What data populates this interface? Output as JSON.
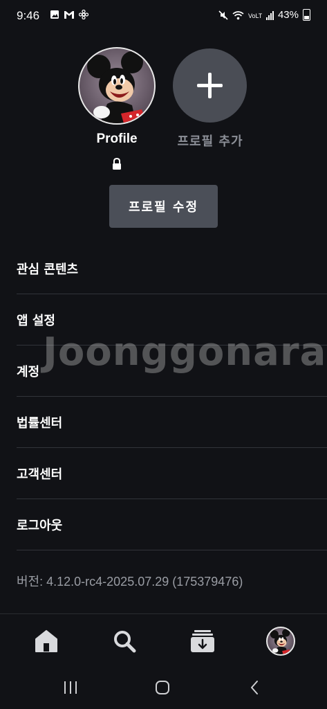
{
  "status_bar": {
    "time": "9:46",
    "left_icons": [
      "gallery-icon",
      "gmail-icon",
      "pinwheel-icon"
    ],
    "right_icons": [
      "mute-icon",
      "wifi-icon",
      "volte-icon",
      "signal-icon"
    ],
    "battery": "43%"
  },
  "profiles": {
    "current_name": "Profile",
    "add_label": "프로필 추가",
    "edit_button": "프로필 수정"
  },
  "menu": {
    "items": [
      "관심 콘텐츠",
      "앱 설정",
      "계정",
      "법률센터",
      "고객센터",
      "로그아웃"
    ]
  },
  "version": "버전: 4.12.0-rc4-2025.07.29 (175379476)",
  "watermark": "Joonggonara",
  "bottom_nav": [
    "home-icon",
    "search-icon",
    "downloads-icon",
    "profile-avatar"
  ],
  "system_nav": [
    "recents-icon",
    "home-button-icon",
    "back-icon"
  ],
  "colors": {
    "background": "#111216",
    "button": "#4b4f58",
    "add_circle": "#4a4d55",
    "divider": "#32343a"
  }
}
